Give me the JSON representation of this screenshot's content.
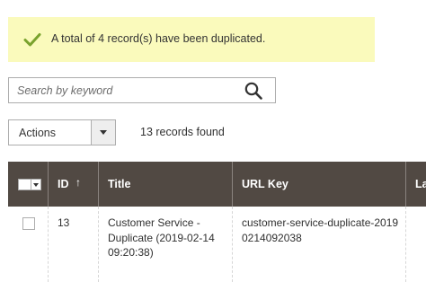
{
  "message": {
    "text": "A total of 4 record(s) have been duplicated.",
    "icon": "checkmark-icon",
    "background": "#fafabc",
    "icon_color": "#79a22e"
  },
  "search": {
    "placeholder": "Search by keyword",
    "value": "",
    "icon": "search-icon"
  },
  "actions": {
    "label": "Actions"
  },
  "records_found": "13 records found",
  "grid": {
    "header_background": "#514943",
    "columns": {
      "id": "ID",
      "id_sort_indicator": "↑",
      "title": "Title",
      "url_key": "URL Key",
      "layout": "Layo"
    },
    "rows": [
      {
        "id": "13",
        "title": "Customer Service - Duplicate (2019-02-14 09:20:38)",
        "url_key": "customer-service-duplicate-20190214092038",
        "checked": false
      }
    ]
  }
}
